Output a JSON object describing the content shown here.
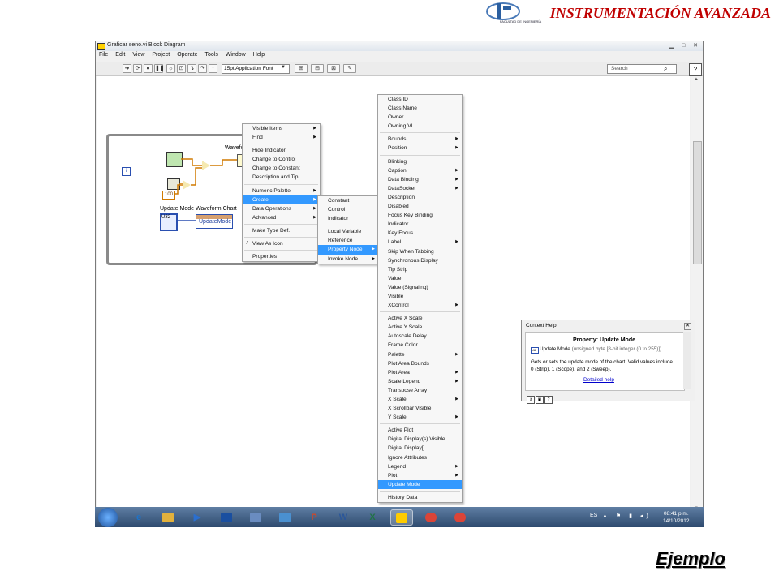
{
  "header": {
    "brand_title": "INSTRUMENTACIÓN AVANZADA",
    "logo_subtext": "FACULTAD DE INGENIERÍA"
  },
  "footer": {
    "label": "Ejemplo"
  },
  "window": {
    "title": "Graficar seno.vi Block Diagram",
    "menu": [
      "File",
      "Edit",
      "View",
      "Project",
      "Operate",
      "Tools",
      "Window",
      "Help"
    ],
    "font_select": "15pt Application Font",
    "search_placeholder": "Search"
  },
  "diagram": {
    "waveform_chart_label": "Waveform Chart",
    "update_mode_label": "Update Mode",
    "waveform_chart_label_2": "Waveform Chart",
    "constant_100": "100",
    "property_node_item": "UpdateMode",
    "iteration_terminal": "i",
    "control_value": "U32"
  },
  "menus": {
    "main": [
      {
        "label": "Visible Items",
        "arrow": true
      },
      {
        "label": "Find",
        "arrow": true
      },
      {
        "sep": true
      },
      {
        "label": "Hide Indicator"
      },
      {
        "label": "Change to Control"
      },
      {
        "label": "Change to Constant"
      },
      {
        "label": "Description and Tip..."
      },
      {
        "sep": true
      },
      {
        "label": "Numeric Palette",
        "arrow": true
      },
      {
        "label": "Create",
        "arrow": true,
        "highlight": true
      },
      {
        "label": "Data Operations",
        "arrow": true
      },
      {
        "label": "Advanced",
        "arrow": true
      },
      {
        "sep": true
      },
      {
        "label": "Make Type Def."
      },
      {
        "sep": true
      },
      {
        "label": "View As Icon",
        "checked": true
      },
      {
        "sep": true
      },
      {
        "label": "Properties"
      }
    ],
    "create": [
      {
        "label": "Constant"
      },
      {
        "label": "Control"
      },
      {
        "label": "Indicator"
      },
      {
        "sep": true
      },
      {
        "label": "Local Variable"
      },
      {
        "label": "Reference"
      },
      {
        "label": "Property Node",
        "arrow": true,
        "highlight": true
      },
      {
        "label": "Invoke Node",
        "arrow": true
      }
    ],
    "property_node": [
      {
        "label": "Class ID"
      },
      {
        "label": "Class Name"
      },
      {
        "label": "Owner"
      },
      {
        "label": "Owning VI"
      },
      {
        "sep": true
      },
      {
        "label": "Bounds",
        "arrow": true
      },
      {
        "label": "Position",
        "arrow": true
      },
      {
        "sep": true
      },
      {
        "label": "Blinking"
      },
      {
        "label": "Caption",
        "arrow": true
      },
      {
        "label": "Data Binding",
        "arrow": true
      },
      {
        "label": "DataSocket",
        "arrow": true
      },
      {
        "label": "Description"
      },
      {
        "label": "Disabled"
      },
      {
        "label": "Focus Key Binding"
      },
      {
        "label": "Indicator"
      },
      {
        "label": "Key Focus"
      },
      {
        "label": "Label",
        "arrow": true
      },
      {
        "label": "Skip When Tabbing"
      },
      {
        "label": "Synchronous Display"
      },
      {
        "label": "Tip Strip"
      },
      {
        "label": "Value"
      },
      {
        "label": "Value (Signaling)"
      },
      {
        "label": "Visible"
      },
      {
        "label": "XControl",
        "arrow": true
      },
      {
        "sep": true
      },
      {
        "label": "Active X Scale"
      },
      {
        "label": "Active Y Scale"
      },
      {
        "label": "Autoscale Delay"
      },
      {
        "label": "Frame Color"
      },
      {
        "label": "Palette",
        "arrow": true
      },
      {
        "label": "Plot Area Bounds"
      },
      {
        "label": "Plot Area",
        "arrow": true
      },
      {
        "label": "Scale Legend",
        "arrow": true
      },
      {
        "label": "Transpose Array"
      },
      {
        "label": "X Scale",
        "arrow": true
      },
      {
        "label": "X Scrollbar Visible"
      },
      {
        "label": "Y Scale",
        "arrow": true
      },
      {
        "sep": true
      },
      {
        "label": "Active Plot"
      },
      {
        "label": "Digital Display(s) Visible"
      },
      {
        "label": "Digital Display[]"
      },
      {
        "label": "Ignore Attributes"
      },
      {
        "label": "Legend",
        "arrow": true
      },
      {
        "label": "Plot",
        "arrow": true
      },
      {
        "label": "Update Mode",
        "highlight": true
      },
      {
        "sep": true
      },
      {
        "label": "History Data"
      }
    ]
  },
  "context_help": {
    "title": "Context Help",
    "heading": "Property: Update Mode",
    "type_name": "Update Mode",
    "type_desc": "(unsigned byte [8-bit integer (0 to 255)])",
    "u8_tag": "U8",
    "description": "Gets or sets the update mode of the chart. Valid values include 0 (Strip), 1 (Scope), and 2 (Sweep).",
    "link": "Detailed help"
  },
  "taskbar": {
    "language": "ES",
    "time": "08:41 p.m.",
    "date": "14/10/2012",
    "apps": [
      "ie-icon",
      "explorer-icon",
      "media-icon",
      "save-icon",
      "labview-icon",
      "paint-icon",
      "powerpoint-icon",
      "word-icon",
      "excel-icon",
      "labview-active-icon",
      "chrome-icon",
      "chrome-icon-2"
    ],
    "app_glyphs": [
      "e",
      "",
      "▶",
      "",
      "",
      "",
      "P",
      "W",
      "X",
      "",
      "",
      ""
    ]
  }
}
